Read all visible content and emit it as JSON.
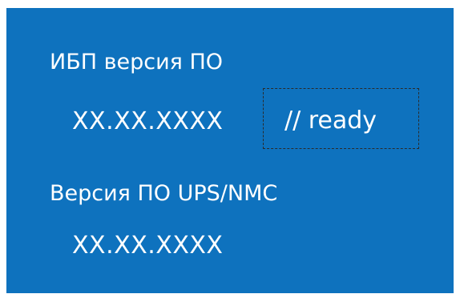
{
  "panel": {
    "background_color": "#0e72be",
    "text_color": "#ffffff",
    "ups_fw_label": "ИБП версия ПО",
    "ups_fw_value": "XX.XX.XXXX",
    "status_text": "// ready",
    "nmc_fw_label": "Версия ПО UPS/NMC",
    "nmc_fw_value": "XX.XX.XXXX"
  }
}
